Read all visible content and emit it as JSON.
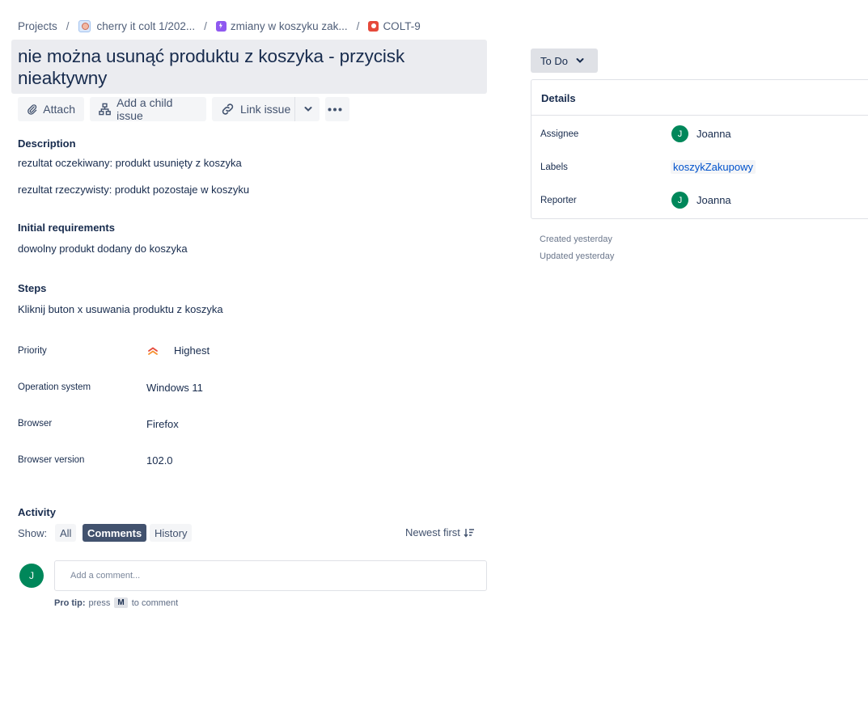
{
  "breadcrumb": {
    "projects": "Projects",
    "project": "cherry it colt 1/202...",
    "epic": "zmiany w koszyku zak...",
    "issue_key": "COLT-9"
  },
  "title": "nie można usunąć produktu z koszyka - przycisk nieaktywny",
  "toolbar": {
    "attach": "Attach",
    "add_child": "Add a child issue",
    "link_issue": "Link issue"
  },
  "description": {
    "heading": "Description",
    "line1": "rezultat oczekiwany: produkt usunięty z koszyka",
    "line2": "rezultat rzeczywisty: produkt pozostaje w koszyku"
  },
  "initial_requirements": {
    "heading": "Initial requirements",
    "text": "dowolny produkt dodany do koszyka"
  },
  "steps": {
    "heading": "Steps",
    "text": "Kliknij buton x usuwania produktu z koszyka"
  },
  "fields": [
    {
      "label": "Priority",
      "value": "Highest"
    },
    {
      "label": "Operation system",
      "value": "Windows 11"
    },
    {
      "label": "Browser",
      "value": "Firefox"
    },
    {
      "label": "Browser version",
      "value": "102.0"
    }
  ],
  "activity": {
    "heading": "Activity",
    "show_label": "Show:",
    "filters": [
      "All",
      "Comments",
      "History"
    ],
    "active_filter": "Comments",
    "sort": "Newest first",
    "comment_placeholder": "Add a comment...",
    "avatar_initial": "J",
    "protip_bold": "Pro tip:",
    "protip_press": "press",
    "protip_key": "M",
    "protip_rest": "to comment"
  },
  "status": "To Do",
  "details": {
    "heading": "Details",
    "assignee_label": "Assignee",
    "assignee": "Joanna",
    "assignee_initial": "J",
    "labels_label": "Labels",
    "label_tag": "koszykZakupowy",
    "reporter_label": "Reporter",
    "reporter": "Joanna",
    "reporter_initial": "J"
  },
  "meta": {
    "created": "Created yesterday",
    "updated": "Updated yesterday"
  },
  "colors": {
    "avatar": "#00875a",
    "priority_highest": "#e5493a",
    "link": "#0052cc"
  },
  "icons": [
    "paperclip-icon",
    "child-issue-icon",
    "link-icon",
    "chevron-down-icon",
    "more-icon",
    "priority-highest-icon",
    "sort-icon"
  ]
}
